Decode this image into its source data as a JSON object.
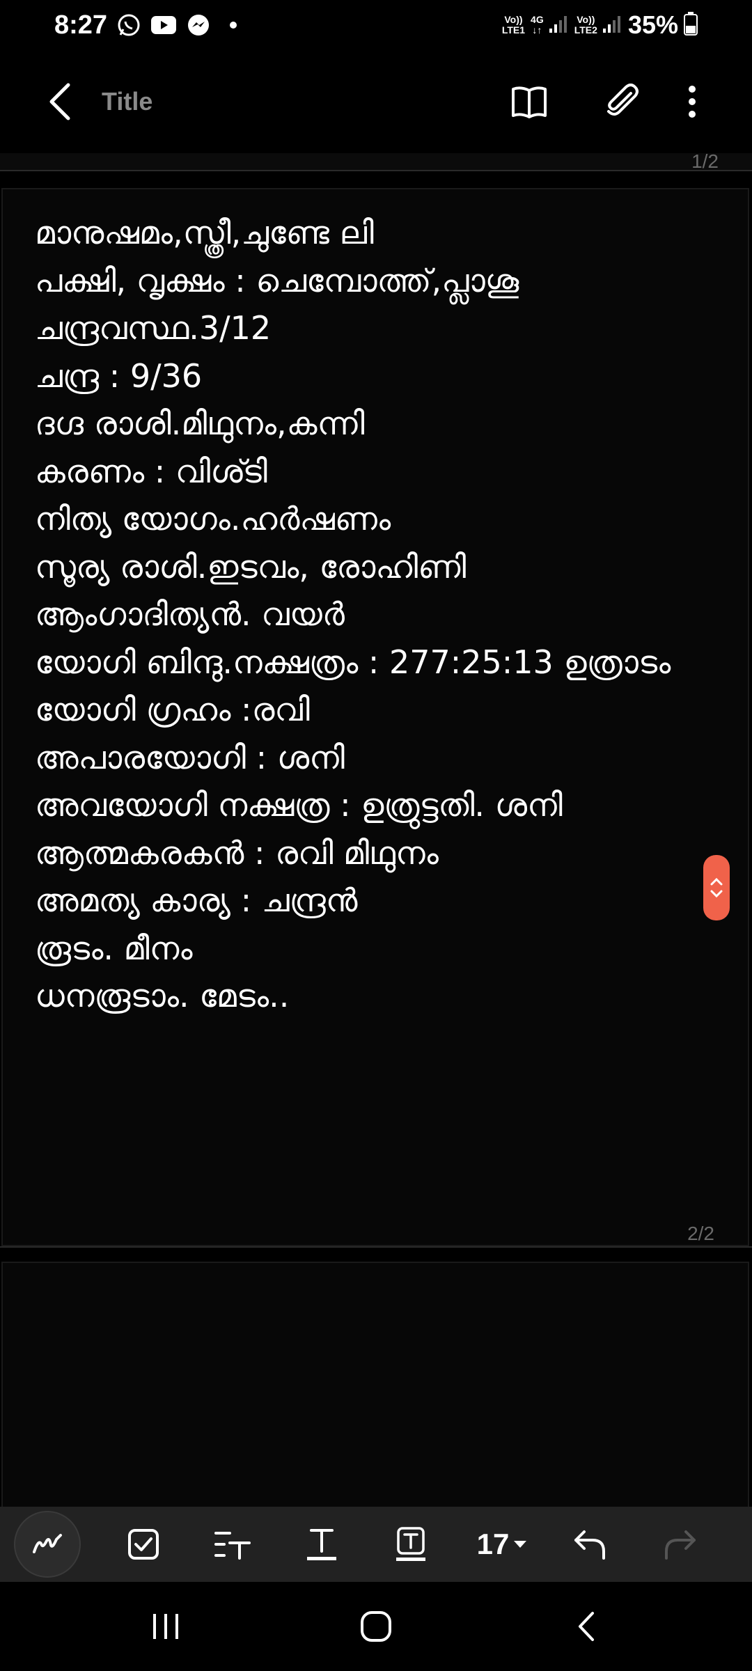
{
  "status_bar": {
    "time": "8:27",
    "notification_icons": [
      "whatsapp-icon",
      "youtube-icon",
      "messenger-icon",
      "dot-icon"
    ],
    "sim1": {
      "top": "Vo))",
      "bottom": "LTE1"
    },
    "network": {
      "top": "4G",
      "bottom": "↓↑"
    },
    "sim2": {
      "top": "Vo))",
      "bottom": "LTE2"
    },
    "battery": "35%"
  },
  "app_bar": {
    "title_placeholder": "Title",
    "icons": [
      "back-icon",
      "book-icon",
      "paperclip-icon",
      "more-vert-icon"
    ]
  },
  "pages": {
    "prev_page_number": "1/2",
    "current_page_number": "2/2"
  },
  "note": {
    "lines": [
      "മാനുഷമം,സ്ത്രീ,ചുണ്ടേ ലി",
      "പക്ഷി, വൃക്ഷം :            ചെമ്പോത്ത്,പ്ലാശൂ",
      "ചന്ദ്രവസ്ഥ.3/12",
      "ചന്ദ്ര : 9/36",
      "ദഗ്ദ രാശി.മിഥുനം,കന്നി",
      "കരണം : വിശ്ടി",
      "നിത്യ യോഗം.ഹർഷണം",
      "സൂര്യ രാശി.ഇടവം, രോഹിണി",
      "ആംഗാദിത്യൻ. വയർ",
      "യോഗി ബിന്ദു.നക്ഷത്രം : 277:25:13 ഉത്രാടം",
      "യോഗി ഗ്രഹം :രവി",
      "അപാരയോഗി : ശനി",
      "അവയോഗി നക്ഷത്ര : ഉത്രുട്ടതി. ശനി",
      "ആത്മകരകൻ : രവി മിഥുനം",
      "അമത്യ കാര്യ : ചന്ദ്രൻ",
      "രൂടം. മീനം",
      "ധനരൂടാം. മേടം.."
    ]
  },
  "bottom_toolbar": {
    "tools": [
      "pen-icon",
      "checkbox-icon",
      "text-style-icon",
      "text-color-icon",
      "text-highlight-icon"
    ],
    "font_size": "17",
    "undo_icon": "undo-icon",
    "redo_icon": "redo-icon"
  },
  "nav_bar": {
    "buttons": [
      "recents-icon",
      "home-icon",
      "back-nav-icon"
    ]
  },
  "colors": {
    "background": "#000000",
    "page": "#070707",
    "accent": "#f0624a",
    "toolbar": "#222222"
  }
}
